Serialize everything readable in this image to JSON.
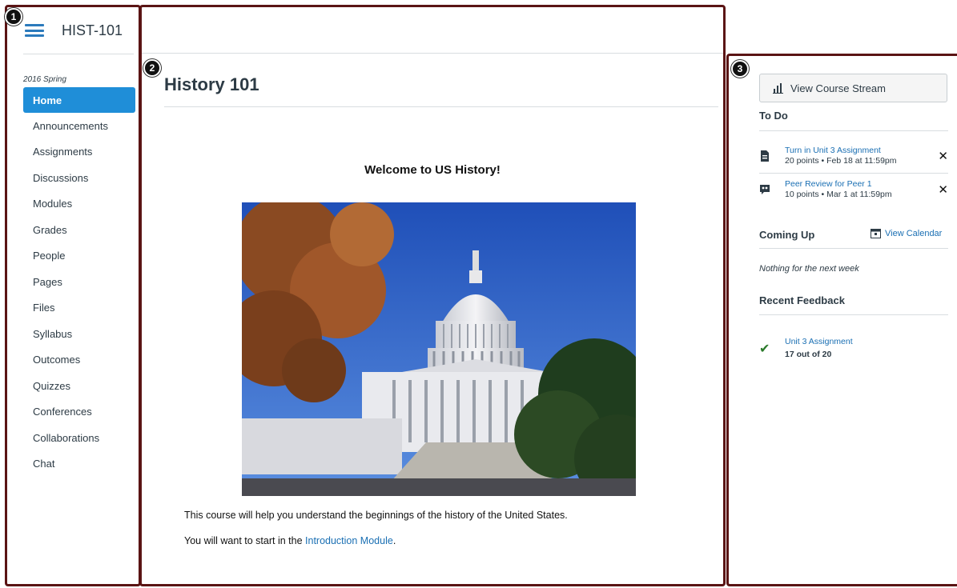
{
  "callouts": [
    "1",
    "2",
    "3"
  ],
  "nav": {
    "course_code": "HIST-101",
    "term": "2016 Spring",
    "items": [
      {
        "label": "Home",
        "active": true
      },
      {
        "label": "Announcements"
      },
      {
        "label": "Assignments"
      },
      {
        "label": "Discussions"
      },
      {
        "label": "Modules"
      },
      {
        "label": "Grades"
      },
      {
        "label": "People"
      },
      {
        "label": "Pages"
      },
      {
        "label": "Files"
      },
      {
        "label": "Syllabus"
      },
      {
        "label": "Outcomes"
      },
      {
        "label": "Quizzes"
      },
      {
        "label": "Conferences"
      },
      {
        "label": "Collaborations"
      },
      {
        "label": "Chat"
      }
    ]
  },
  "main": {
    "title": "History 101",
    "welcome": "Welcome to US History!",
    "image_subject": "capitol-building-photo",
    "paragraph1": "This course will help you understand the beginnings of the history of the United States.",
    "paragraph2_prefix": "You will want to start in the ",
    "paragraph2_link": "Introduction Module",
    "paragraph2_suffix": "."
  },
  "sidebar": {
    "stream_button": "View Course Stream",
    "todo_heading": "To Do",
    "todo": [
      {
        "title": "Turn in Unit 3 Assignment",
        "meta": "20 points • Feb 18 at 11:59pm",
        "icon": "assignment-icon"
      },
      {
        "title": "Peer Review for Peer 1",
        "meta": "10 points • Mar 1 at 11:59pm",
        "icon": "peer-review-icon"
      }
    ],
    "coming_up_heading": "Coming Up",
    "view_calendar": "View Calendar",
    "nothing_text": "Nothing for the next week",
    "feedback_heading": "Recent Feedback",
    "feedback": {
      "title": "Unit 3 Assignment",
      "score": "17 out of 20"
    }
  },
  "colors": {
    "accent": "#1f8ed8",
    "link": "#1a6fb3",
    "panel_border": "#5a1414",
    "check": "#2a7a2a"
  }
}
